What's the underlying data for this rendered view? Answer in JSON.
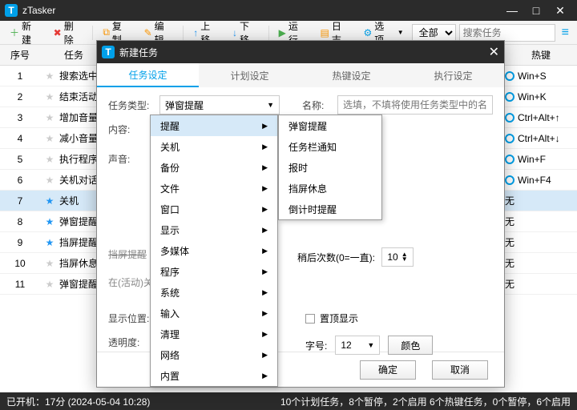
{
  "app": {
    "title": "zTasker"
  },
  "toolbar": {
    "new": "新建",
    "delete": "删除",
    "copy": "复制",
    "edit": "编辑",
    "up": "上移",
    "down": "下移",
    "run": "运行",
    "log": "日志",
    "options": "选项"
  },
  "search": {
    "all": "全部",
    "placeholder": "搜索任务"
  },
  "columns": {
    "num": "序号",
    "task": "任务",
    "hotkey": "热键"
  },
  "rows": [
    {
      "n": 1,
      "name": "搜索选中文",
      "hk": "Win+S",
      "star": false
    },
    {
      "n": 2,
      "name": "结束活动窗",
      "hk": "Win+K",
      "star": false
    },
    {
      "n": 3,
      "name": "增加音量",
      "hk": "Ctrl+Alt+↑",
      "star": false
    },
    {
      "n": 4,
      "name": "减小音量",
      "hk": "Ctrl+Alt+↓",
      "star": false
    },
    {
      "n": 5,
      "name": "执行程序",
      "hk": "Win+F",
      "star": false
    },
    {
      "n": 6,
      "name": "关机对话框",
      "hk": "Win+F4",
      "star": false
    },
    {
      "n": 7,
      "name": "关机",
      "hk": "无",
      "star": true,
      "sel": true
    },
    {
      "n": 8,
      "name": "弹窗提醒",
      "hk": "无",
      "star": true
    },
    {
      "n": 9,
      "name": "挡屏提醒",
      "hk": "无",
      "star": true
    },
    {
      "n": 10,
      "name": "挡屏休息",
      "hk": "无",
      "star": false
    },
    {
      "n": 11,
      "name": "弹窗提醒",
      "hk": "无",
      "star": false
    }
  ],
  "dialog": {
    "title": "新建任务",
    "tabs": [
      "任务设定",
      "计划设定",
      "热键设定",
      "执行设定"
    ],
    "labels": {
      "type": "任务类型:",
      "name": "名称:",
      "content": "内容:",
      "sound": "声音:",
      "pos": "显示位置:",
      "opacity": "透明度:",
      "delay": "稍后次数(0=一直):",
      "top": "置顶显示",
      "font": "字号:",
      "color": "颜色"
    },
    "typeValue": "弹窗提醒",
    "namePh": "选填，不填将使用任务类型中的名称",
    "delayVal": "10",
    "fontVal": "12",
    "ok": "确定",
    "cancel": "取消",
    "ghost1": "挡屏提醒",
    "ghost2": "在(活动)关闭"
  },
  "menu1": [
    "提醒",
    "关机",
    "备份",
    "文件",
    "窗口",
    "显示",
    "多媒体",
    "程序",
    "系统",
    "输入",
    "清理",
    "网络",
    "内置"
  ],
  "menu2": [
    "弹窗提醒",
    "任务栏通知",
    "报时",
    "挡屏休息",
    "倒计时提醒"
  ],
  "status": {
    "left": "已开机：17分 (2024-05-04 10:28)",
    "right": "10个计划任务，8个暂停，2个启用   6个热键任务，0个暂停，6个启用"
  }
}
